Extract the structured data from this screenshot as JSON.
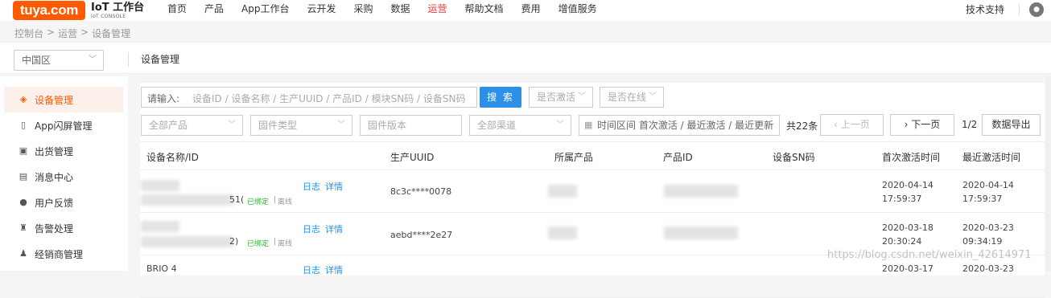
{
  "header": {
    "logo_text": "tuya.com",
    "title": "IoT 工作台",
    "subtitle": "IoT CONSOLE",
    "nav": [
      {
        "label": "首页",
        "active": false
      },
      {
        "label": "产品",
        "active": false
      },
      {
        "label": "App工作台",
        "active": false
      },
      {
        "label": "云开发",
        "active": false
      },
      {
        "label": "采购",
        "active": false
      },
      {
        "label": "数据",
        "active": false
      },
      {
        "label": "运营",
        "active": true
      },
      {
        "label": "帮助文档",
        "active": false
      },
      {
        "label": "费用",
        "active": false
      },
      {
        "label": "增值服务",
        "active": false
      }
    ],
    "support": "技术支持",
    "accent": "#e4393c",
    "brand": "#ff5a00"
  },
  "breadcrumb": [
    "控制台",
    ">",
    "运营",
    ">",
    "设备管理"
  ],
  "region": {
    "selected": "中国区",
    "page_title": "设备管理"
  },
  "sidebar": {
    "items": [
      {
        "label": "设备管理",
        "icon": "layers-icon",
        "active": true
      },
      {
        "label": "App闪屏管理",
        "icon": "phone-icon",
        "active": false
      },
      {
        "label": "出货管理",
        "icon": "box-icon",
        "active": false
      },
      {
        "label": "消息中心",
        "icon": "chat-icon",
        "active": false
      },
      {
        "label": "用户反馈",
        "icon": "feedback-icon",
        "active": false
      },
      {
        "label": "告警处理",
        "icon": "alarm-icon",
        "active": false
      },
      {
        "label": "经销商管理",
        "icon": "dealer-icon",
        "active": false
      }
    ]
  },
  "filters": {
    "search_label": "请输入:",
    "search_placeholder": "设备ID / 设备名称 / 生产UUID / 产品ID / 模块SN码 / 设备SN码",
    "search_button": "搜 索",
    "activated": "是否激活",
    "online": "是否在线",
    "product": "全部产品",
    "firmware_type": "固件类型",
    "firmware_version": "固件版本",
    "channel": "全部渠道",
    "date_range": "时间区间  首次激活 / 最近激活 / 最近更新"
  },
  "pager": {
    "total": "共22条",
    "prev": "上一页",
    "next": "下一页",
    "page": "1/2",
    "export": "数据导出"
  },
  "table": {
    "columns": [
      "设备名称/ID",
      "生产UUID",
      "所属产品",
      "产品ID",
      "设备SN码",
      "首次激活时间",
      "最近激活时间"
    ],
    "rows": [
      {
        "id_suffix": "51(",
        "bound": "已绑定",
        "status": "离线",
        "log": "日志",
        "detail": "详情",
        "uuid": "8c3c****0078",
        "first_date": "2020-04-14",
        "first_time": "17:59:37",
        "last_date": "2020-04-14",
        "last_time": "17:59:37"
      },
      {
        "id_suffix": "2)",
        "bound": "已绑定",
        "status": "离线",
        "log": "日志",
        "detail": "详情",
        "uuid": "aebd****2e27",
        "first_date": "2020-03-18",
        "first_time": "20:30:24",
        "last_date": "2020-03-23",
        "last_time": "09:34:19"
      },
      {
        "name": "BRIO 4",
        "log": "日志",
        "detail": "详情",
        "first_date": "2020-03-17",
        "last_date": "2020-03-23"
      }
    ]
  },
  "watermark": "https://blog.csdn.net/weixin_42614971"
}
